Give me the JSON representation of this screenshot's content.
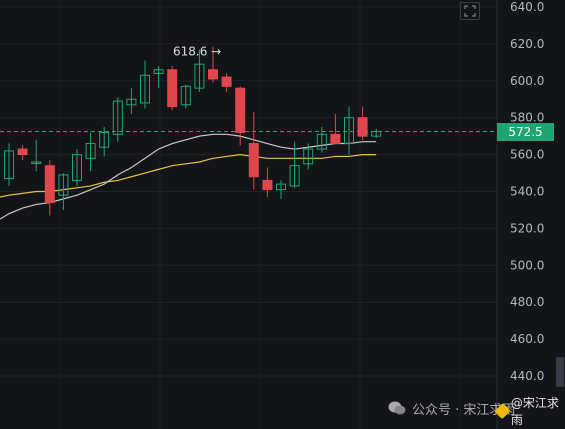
{
  "chart_data": {
    "type": "candlestick",
    "y_ticks": [
      "640.0",
      "620.0",
      "600.0",
      "580.0",
      "560.0",
      "540.0",
      "520.0",
      "500.0",
      "480.0",
      "460.0",
      "440.0"
    ],
    "ylim": [
      430,
      642
    ],
    "current_price": "572.5",
    "current_price_value": 572.5,
    "high_annotation": "618.6",
    "high_annotation_value": 618.6,
    "colors": {
      "up": "#1fa573",
      "down": "#e0474c",
      "ma_fast": "#c8c8c8",
      "ma_slow": "#e8c33a",
      "price_line": "#1fa573",
      "background": "#131418"
    },
    "candles": [
      {
        "o": 547,
        "h": 566,
        "l": 543,
        "c": 562
      },
      {
        "o": 563,
        "h": 565,
        "l": 557,
        "c": 560
      },
      {
        "o": 556,
        "h": 568,
        "l": 551,
        "c": 556
      },
      {
        "o": 554,
        "h": 557,
        "l": 527,
        "c": 534
      },
      {
        "o": 538,
        "h": 550,
        "l": 530,
        "c": 549
      },
      {
        "o": 546,
        "h": 563,
        "l": 543,
        "c": 560
      },
      {
        "o": 558,
        "h": 572,
        "l": 551,
        "c": 566
      },
      {
        "o": 564,
        "h": 575,
        "l": 559,
        "c": 572
      },
      {
        "o": 571,
        "h": 591,
        "l": 567,
        "c": 589
      },
      {
        "o": 587,
        "h": 596,
        "l": 582,
        "c": 590
      },
      {
        "o": 588,
        "h": 611,
        "l": 585,
        "c": 603
      },
      {
        "o": 604,
        "h": 608,
        "l": 596,
        "c": 606
      },
      {
        "o": 606,
        "h": 608,
        "l": 584,
        "c": 586
      },
      {
        "o": 587,
        "h": 598,
        "l": 585,
        "c": 597
      },
      {
        "o": 596,
        "h": 617,
        "l": 594,
        "c": 609
      },
      {
        "o": 606,
        "h": 618.6,
        "l": 599,
        "c": 601
      },
      {
        "o": 602,
        "h": 604,
        "l": 594,
        "c": 597
      },
      {
        "o": 596,
        "h": 597,
        "l": 565,
        "c": 572
      },
      {
        "o": 566,
        "h": 583,
        "l": 541,
        "c": 548
      },
      {
        "o": 546,
        "h": 553,
        "l": 537,
        "c": 541
      },
      {
        "o": 541,
        "h": 546,
        "l": 536,
        "c": 544
      },
      {
        "o": 543,
        "h": 567,
        "l": 542,
        "c": 554
      },
      {
        "o": 555,
        "h": 566,
        "l": 552,
        "c": 563
      },
      {
        "o": 563,
        "h": 575,
        "l": 561,
        "c": 571
      },
      {
        "o": 571,
        "h": 582,
        "l": 568,
        "c": 566
      },
      {
        "o": 566,
        "h": 586,
        "l": 560,
        "c": 580
      },
      {
        "o": 580,
        "h": 586,
        "l": 568,
        "c": 570
      },
      {
        "o": 570,
        "h": 574,
        "l": 569,
        "c": 572.5
      }
    ],
    "ma_fast": [
      528,
      531,
      533,
      534,
      536,
      538,
      541,
      544,
      549,
      553,
      558,
      563,
      566,
      568,
      570,
      571,
      571,
      570,
      568,
      566,
      564,
      563,
      564,
      565,
      566,
      566,
      567,
      567
    ],
    "ma_slow": [
      538,
      539,
      540,
      540,
      541,
      542,
      543,
      545,
      546,
      548,
      550,
      552,
      554,
      555,
      556,
      558,
      559,
      560,
      559,
      558,
      558,
      558,
      558,
      558,
      559,
      559,
      560,
      560
    ]
  },
  "ui": {
    "watermark": "公众号 · 宋江求雨",
    "handle": "@宋江求雨",
    "expand_icon": "expand-icon",
    "arrow": "→"
  }
}
